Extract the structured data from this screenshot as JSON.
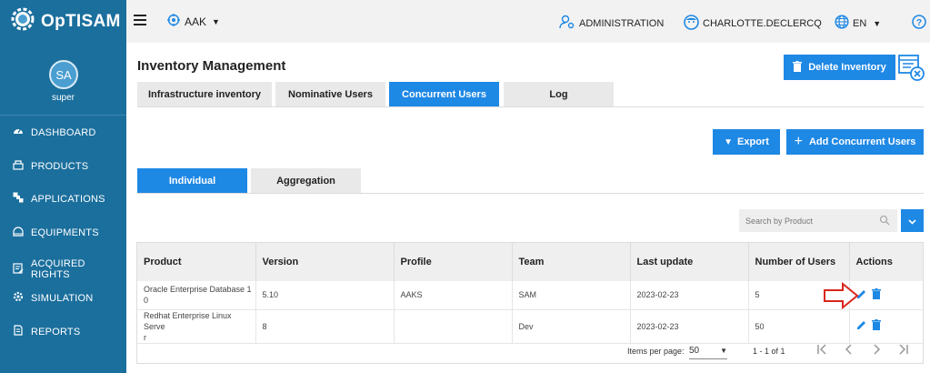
{
  "header": {
    "brand": "OpTISAM",
    "scope": "AAK",
    "administration": "ADMINISTRATION",
    "user": "CHARLOTTE.DECLERCQ",
    "language": "EN"
  },
  "sidebar": {
    "avatar_initials": "SA",
    "user_name": "super",
    "items": [
      {
        "label": "DASHBOARD",
        "icon": "dashboard-icon"
      },
      {
        "label": "PRODUCTS",
        "icon": "products-icon"
      },
      {
        "label": "APPLICATIONS",
        "icon": "applications-icon"
      },
      {
        "label": "EQUIPMENTS",
        "icon": "equipments-icon"
      },
      {
        "label": "ACQUIRED RIGHTS",
        "icon": "acquired-rights-icon"
      },
      {
        "label": "SIMULATION",
        "icon": "simulation-icon"
      },
      {
        "label": "REPORTS",
        "icon": "reports-icon"
      }
    ]
  },
  "page": {
    "title": "Inventory Management",
    "delete_button": "Delete Inventory",
    "tabs": [
      "Infrastructure inventory",
      "Nominative Users",
      "Concurrent Users",
      "Log"
    ],
    "active_tab": "Concurrent Users",
    "export_button": "Export",
    "add_button": "Add Concurrent Users",
    "subtabs": [
      "Individual",
      "Aggregation"
    ],
    "active_subtab": "Individual",
    "search_placeholder": "Search by Product"
  },
  "table": {
    "columns": [
      "Product",
      "Version",
      "Profile",
      "Team",
      "Last update",
      "Number of Users",
      "Actions"
    ],
    "rows": [
      {
        "product": "Oracle Enterprise Database 1\n0",
        "version": "5.10",
        "profile": "AAKS",
        "team": "SAM",
        "last_update": "2023-02-23",
        "users": "5"
      },
      {
        "product": "Redhat Enterprise Linux Serve\nr",
        "version": "8",
        "profile": "",
        "team": "Dev",
        "last_update": "2023-02-23",
        "users": "50"
      }
    ]
  },
  "pager": {
    "items_per_page_label": "Items per page:",
    "items_per_page": "50",
    "range": "1 - 1 of 1"
  },
  "colors": {
    "brand": "#1b6f9d",
    "primary": "#1e88e5",
    "annotation_arrow": "#d9261c"
  }
}
